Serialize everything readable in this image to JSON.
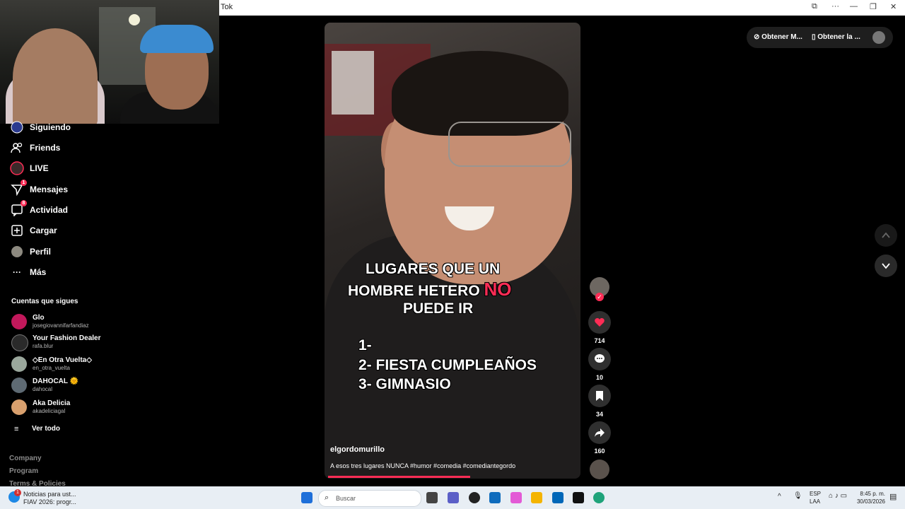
{
  "window": {
    "title": "Tok"
  },
  "nav": [
    {
      "label": "Siguiendo",
      "icon": "following-avatar-icon",
      "badge": ""
    },
    {
      "label": "Friends",
      "icon": "friends-icon",
      "badge": ""
    },
    {
      "label": "LIVE",
      "icon": "live-icon",
      "badge": ""
    },
    {
      "label": "Mensajes",
      "icon": "messages-icon",
      "badge": "1"
    },
    {
      "label": "Actividad",
      "icon": "activity-icon",
      "badge": "8"
    },
    {
      "label": "Cargar",
      "icon": "upload-icon",
      "badge": ""
    },
    {
      "label": "Perfil",
      "icon": "profile-icon",
      "badge": ""
    },
    {
      "label": "Más",
      "icon": "more-icon",
      "badge": ""
    }
  ],
  "following": {
    "title": "Cuentas que sigues",
    "accounts": [
      {
        "name": "Glo",
        "handle": "josegiovannifarfandiaz",
        "color": "#c2185b"
      },
      {
        "name": "Your Fashion Dealer",
        "handle": "rafa.blur",
        "color": "#2a2a2a"
      },
      {
        "name": "◇En Otra Vuelta◇",
        "handle": "en_otra_vuelta",
        "color": "#9aa79c"
      },
      {
        "name": "DAHOCAL 🌞",
        "handle": "dahocal",
        "color": "#5e6a73"
      },
      {
        "name": "Aka Delicia",
        "handle": "akadeliciagal",
        "color": "#d9a06e"
      }
    ],
    "see_all": "Ver todo"
  },
  "footer": [
    "Company",
    "Program",
    "Terms & Policies"
  ],
  "video": {
    "overlay_line1": "LUGARES QUE UN",
    "overlay_line2a": "HOMBRE HETERO",
    "overlay_line2b": "NO",
    "overlay_line3": "PUEDE IR",
    "list1": "1-",
    "list2": "2- FIESTA CUMPLEAÑOS",
    "list3": "3- GIMNASIO",
    "author": "elgordomurillo",
    "caption": "A esos tres lugares NUNCA #humor #comedia #comediantegordo",
    "progress": 0.57
  },
  "actions": {
    "likes": "714",
    "comments": "10",
    "saves": "34",
    "shares": "160"
  },
  "top_right": {
    "get_app1": "Obtener M...",
    "get_app2": "Obtener la ..."
  },
  "taskbar": {
    "news_line1": "Noticias para ust...",
    "news_line2": "FIAV 2026: progr...",
    "news_badge": "1",
    "search_placeholder": "Buscar",
    "lang1": "ESP",
    "lang2": "LAA",
    "time": "8:45 p. m.",
    "date": "30/03/2026"
  }
}
